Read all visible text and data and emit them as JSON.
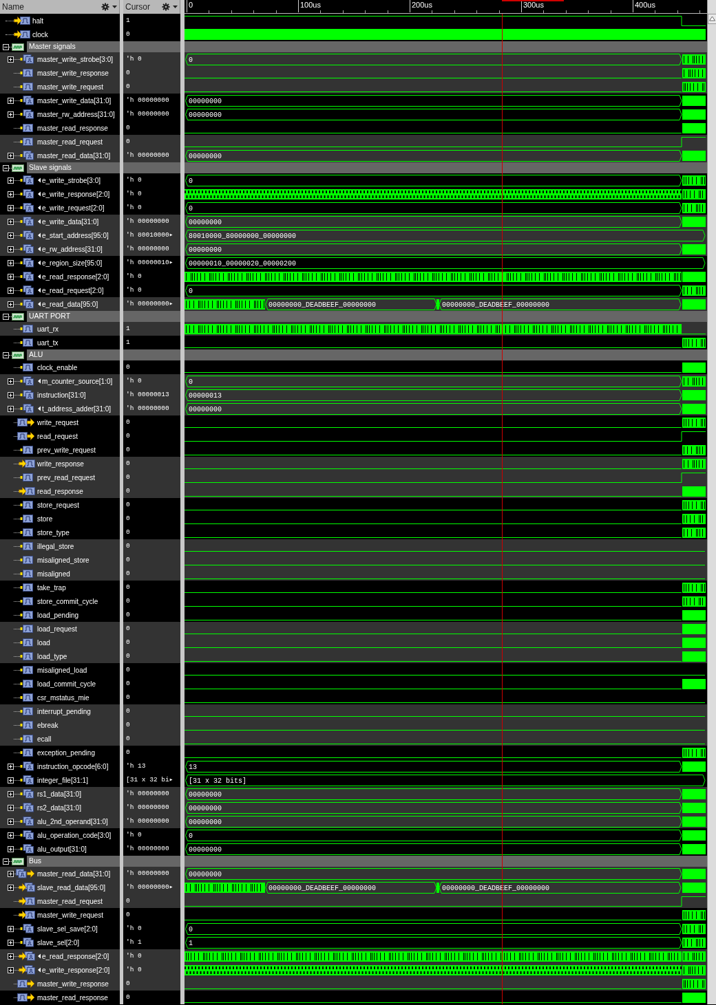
{
  "columns": {
    "name": "Name",
    "cursor": "Cursor"
  },
  "ruler": {
    "ticks": [
      "0",
      "100us",
      "200us",
      "300us",
      "400us"
    ]
  },
  "rows": [
    {
      "kind": "in",
      "name": "halt",
      "value": "1",
      "truncated": false,
      "wave": {
        "kind": "high-fall"
      }
    },
    {
      "kind": "in",
      "name": "clock",
      "value": "0",
      "truncated": false,
      "wave": {
        "kind": "clock"
      }
    },
    {
      "kind": "group",
      "name": "Master signals",
      "expanded": true,
      "children": [
        {
          "kind": "bus",
          "name": "master_write_strobe[3:0]",
          "value": "'h 0",
          "truncated": false,
          "expanded": false,
          "wave": {
            "kind": "bus-ticks",
            "label": "0"
          }
        },
        {
          "kind": "internal",
          "name": "master_write_response",
          "value": "0",
          "truncated": false,
          "wave": {
            "kind": "low-ticks"
          }
        },
        {
          "kind": "internal",
          "name": "master_write_request",
          "value": "0",
          "truncated": false,
          "wave": {
            "kind": "low-ticks"
          }
        },
        {
          "kind": "bus",
          "name": "master_write_data[31:0]",
          "value": "'h 00000000",
          "truncated": false,
          "expanded": false,
          "wave": {
            "kind": "bus-solid",
            "label": "00000000"
          }
        },
        {
          "kind": "bus",
          "name": "master_rw_address[31:0]",
          "value": "'h 00000000",
          "truncated": false,
          "expanded": false,
          "wave": {
            "kind": "bus-solid",
            "label": "00000000"
          }
        },
        {
          "kind": "internal",
          "name": "master_read_response",
          "value": "0",
          "truncated": false,
          "wave": {
            "kind": "low-solid"
          }
        },
        {
          "kind": "internal",
          "name": "master_read_request",
          "value": "0",
          "truncated": false,
          "wave": {
            "kind": "low-rise"
          }
        },
        {
          "kind": "bus",
          "name": "master_read_data[31:0]",
          "value": "'h 00000000",
          "truncated": false,
          "expanded": false,
          "wave": {
            "kind": "bus-solid",
            "label": "00000000"
          }
        }
      ]
    },
    {
      "kind": "group",
      "name": "Slave signals",
      "expanded": true,
      "children": [
        {
          "kind": "bus",
          "name": "e_write_strobe[3:0]",
          "value": "'h 0",
          "truncated": true,
          "expanded": false,
          "wave": {
            "kind": "bus-ticks",
            "label": "0"
          }
        },
        {
          "kind": "bus",
          "name": "e_write_response[2:0]",
          "value": "'h 0",
          "truncated": true,
          "expanded": false,
          "wave": {
            "kind": "toggle-ticks"
          }
        },
        {
          "kind": "bus",
          "name": "e_write_request[2:0]",
          "value": "'h 0",
          "truncated": true,
          "expanded": false,
          "wave": {
            "kind": "bus-ticks",
            "label": "0"
          }
        },
        {
          "kind": "bus",
          "name": "e_write_data[31:0]",
          "value": "'h 00000000",
          "truncated": true,
          "expanded": false,
          "wave": {
            "kind": "bus-solid",
            "label": "00000000"
          }
        },
        {
          "kind": "bus",
          "name": "e_start_address[95:0]",
          "value": "'h 80010000▸",
          "truncated": true,
          "expanded": false,
          "wave": {
            "kind": "bus-none",
            "label": "80010000_80000000_00000000"
          }
        },
        {
          "kind": "bus",
          "name": "e_rw_address[31:0]",
          "value": "'h 00000000",
          "truncated": true,
          "expanded": false,
          "wave": {
            "kind": "bus-solid",
            "label": "00000000"
          }
        },
        {
          "kind": "bus",
          "name": "e_region_size[95:0]",
          "value": "'h 00000010▸",
          "truncated": true,
          "expanded": false,
          "wave": {
            "kind": "bus-none",
            "label": "00000010_00000020_00000200"
          }
        },
        {
          "kind": "bus",
          "name": "e_read_response[2:0]",
          "value": "'h 0",
          "truncated": true,
          "expanded": false,
          "wave": {
            "kind": "pulses-solid"
          }
        },
        {
          "kind": "bus",
          "name": "e_read_request[2:0]",
          "value": "'h 0",
          "truncated": true,
          "expanded": false,
          "wave": {
            "kind": "bus-ticks",
            "label": "0"
          }
        },
        {
          "kind": "bus",
          "name": "e_read_data[95:0]",
          "value": "'h 00000000▸",
          "truncated": true,
          "expanded": false,
          "wave": {
            "kind": "mixed-solid",
            "labels": [
              "00000000_DEADBEEF_00000000",
              "00000000_DEADBEEF_00000000"
            ]
          }
        }
      ]
    },
    {
      "kind": "group",
      "name": "UART PORT",
      "expanded": true,
      "children": [
        {
          "kind": "internal",
          "name": "uart_rx",
          "value": "1",
          "truncated": false,
          "wave": {
            "kind": "pulses-low"
          }
        },
        {
          "kind": "internal",
          "name": "uart_tx",
          "value": "1",
          "truncated": false,
          "wave": {
            "kind": "low-ticks"
          }
        }
      ]
    },
    {
      "kind": "group",
      "name": "ALU",
      "expanded": true,
      "children": [
        {
          "kind": "internal",
          "name": "clock_enable",
          "value": "0",
          "truncated": false,
          "wave": {
            "kind": "low-solid"
          }
        },
        {
          "kind": "bus",
          "name": "m_counter_source[1:0]",
          "value": "'h 0",
          "truncated": true,
          "expanded": false,
          "wave": {
            "kind": "bus-ticks",
            "label": "0"
          }
        },
        {
          "kind": "bus",
          "name": "instruction[31:0]",
          "value": "'h 00000013",
          "truncated": false,
          "expanded": false,
          "wave": {
            "kind": "bus-solid",
            "label": "00000013"
          }
        },
        {
          "kind": "bus",
          "name": "t_address_adder[31:0]",
          "value": "'h 00000000",
          "truncated": true,
          "expanded": false,
          "wave": {
            "kind": "bus-solid",
            "label": "00000000"
          }
        },
        {
          "kind": "out",
          "name": "write_request",
          "value": "0",
          "truncated": false,
          "wave": {
            "kind": "low-ticks"
          }
        },
        {
          "kind": "out",
          "name": "read_request",
          "value": "0",
          "truncated": false,
          "wave": {
            "kind": "low-rise"
          }
        },
        {
          "kind": "internal",
          "name": "prev_write_request",
          "value": "0",
          "truncated": false,
          "wave": {
            "kind": "low-ticks"
          }
        },
        {
          "kind": "in",
          "name": "write_response",
          "value": "0",
          "truncated": false,
          "wave": {
            "kind": "low-ticks"
          }
        },
        {
          "kind": "internal",
          "name": "prev_read_request",
          "value": "0",
          "truncated": false,
          "wave": {
            "kind": "low-rise"
          }
        },
        {
          "kind": "in",
          "name": "read_response",
          "value": "0",
          "truncated": false,
          "wave": {
            "kind": "low-solid"
          }
        },
        {
          "kind": "internal",
          "name": "store_request",
          "value": "0",
          "truncated": false,
          "wave": {
            "kind": "low-ticks"
          }
        },
        {
          "kind": "internal",
          "name": "store",
          "value": "0",
          "truncated": false,
          "wave": {
            "kind": "low-ticks"
          }
        },
        {
          "kind": "internal",
          "name": "store_type",
          "value": "0",
          "truncated": false,
          "wave": {
            "kind": "low-ticks"
          }
        },
        {
          "kind": "internal",
          "name": "illegal_store",
          "value": "0",
          "truncated": false,
          "wave": {
            "kind": "low-none"
          }
        },
        {
          "kind": "internal",
          "name": "misaligned_store",
          "value": "0",
          "truncated": false,
          "wave": {
            "kind": "low-none"
          }
        },
        {
          "kind": "internal",
          "name": "misaligned",
          "value": "0",
          "truncated": false,
          "wave": {
            "kind": "low-none"
          }
        },
        {
          "kind": "internal",
          "name": "take_trap",
          "value": "0",
          "truncated": false,
          "wave": {
            "kind": "low-ticks"
          }
        },
        {
          "kind": "internal",
          "name": "store_commit_cycle",
          "value": "0",
          "truncated": false,
          "wave": {
            "kind": "low-ticks"
          }
        },
        {
          "kind": "internal",
          "name": "load_pending",
          "value": "0",
          "truncated": false,
          "wave": {
            "kind": "low-solid"
          }
        },
        {
          "kind": "internal",
          "name": "load_request",
          "value": "0",
          "truncated": false,
          "wave": {
            "kind": "low-solid"
          }
        },
        {
          "kind": "internal",
          "name": "load",
          "value": "0",
          "truncated": false,
          "wave": {
            "kind": "low-solid"
          }
        },
        {
          "kind": "internal",
          "name": "load_type",
          "value": "0",
          "truncated": false,
          "wave": {
            "kind": "low-solid"
          }
        },
        {
          "kind": "internal",
          "name": "misaligned_load",
          "value": "0",
          "truncated": false,
          "wave": {
            "kind": "low-none"
          }
        },
        {
          "kind": "internal",
          "name": "load_commit_cycle",
          "value": "0",
          "truncated": false,
          "wave": {
            "kind": "low-solid"
          }
        },
        {
          "kind": "internal",
          "name": "csr_mstatus_mie",
          "value": "0",
          "truncated": false,
          "wave": {
            "kind": "low-none"
          }
        },
        {
          "kind": "internal",
          "name": "interrupt_pending",
          "value": "0",
          "truncated": false,
          "wave": {
            "kind": "low-none"
          }
        },
        {
          "kind": "internal",
          "name": "ebreak",
          "value": "0",
          "truncated": false,
          "wave": {
            "kind": "low-none"
          }
        },
        {
          "kind": "internal",
          "name": "ecall",
          "value": "0",
          "truncated": false,
          "wave": {
            "kind": "low-none"
          }
        },
        {
          "kind": "internal",
          "name": "exception_pending",
          "value": "0",
          "truncated": false,
          "wave": {
            "kind": "low-ticks"
          }
        },
        {
          "kind": "bus",
          "name": "instruction_opcode[6:0]",
          "value": "'h 13",
          "truncated": false,
          "expanded": false,
          "wave": {
            "kind": "bus-solid",
            "label": "13"
          }
        },
        {
          "kind": "bus",
          "name": "integer_file[31:1]",
          "value": "[31 x 32 bi▸",
          "truncated": false,
          "expanded": false,
          "wave": {
            "kind": "bus-none",
            "label": "[31 x 32 bits]"
          }
        },
        {
          "kind": "bus",
          "name": "rs1_data[31:0]",
          "value": "'h 00000000",
          "truncated": false,
          "expanded": false,
          "wave": {
            "kind": "bus-solid",
            "label": "00000000"
          }
        },
        {
          "kind": "bus",
          "name": "rs2_data[31:0]",
          "value": "'h 00000000",
          "truncated": false,
          "expanded": false,
          "wave": {
            "kind": "bus-solid",
            "label": "00000000"
          }
        },
        {
          "kind": "bus",
          "name": "alu_2nd_operand[31:0]",
          "value": "'h 00000000",
          "truncated": false,
          "expanded": false,
          "wave": {
            "kind": "bus-solid",
            "label": "00000000"
          }
        },
        {
          "kind": "bus",
          "name": "alu_operation_code[3:0]",
          "value": "'h 0",
          "truncated": false,
          "expanded": false,
          "wave": {
            "kind": "bus-solid",
            "label": "0"
          }
        },
        {
          "kind": "bus",
          "name": "alu_output[31:0]",
          "value": "'h 00000000",
          "truncated": false,
          "expanded": false,
          "wave": {
            "kind": "bus-solid",
            "label": "00000000"
          }
        }
      ]
    },
    {
      "kind": "group",
      "name": "Bus",
      "expanded": true,
      "children": [
        {
          "kind": "bus-out",
          "name": "master_read_data[31:0]",
          "value": "'h 00000000",
          "truncated": false,
          "expanded": false,
          "wave": {
            "kind": "bus-solid",
            "label": "00000000"
          }
        },
        {
          "kind": "bus-in",
          "name": "slave_read_data[95:0]",
          "value": "'h 00000000▸",
          "truncated": false,
          "expanded": false,
          "wave": {
            "kind": "mixed-solid",
            "labels": [
              "00000000_DEADBEEF_00000000",
              "00000000_DEADBEEF_00000000"
            ]
          }
        },
        {
          "kind": "in",
          "name": "master_read_request",
          "value": "0",
          "truncated": false,
          "wave": {
            "kind": "low-rise"
          }
        },
        {
          "kind": "in",
          "name": "master_write_request",
          "value": "0",
          "truncated": false,
          "wave": {
            "kind": "low-ticks"
          }
        },
        {
          "kind": "bus",
          "name": "slave_sel_save[2:0]",
          "value": "'h 0",
          "truncated": false,
          "expanded": false,
          "wave": {
            "kind": "bus-ticks",
            "label": "0"
          }
        },
        {
          "kind": "bus",
          "name": "slave_sel[2:0]",
          "value": "'h 1",
          "truncated": false,
          "expanded": false,
          "wave": {
            "kind": "bus-ticks",
            "label": "1"
          }
        },
        {
          "kind": "bus-in",
          "name": "e_read_response[2:0]",
          "value": "'h 0",
          "truncated": true,
          "expanded": false,
          "wave": {
            "kind": "pulses-ticks"
          }
        },
        {
          "kind": "bus-in",
          "name": "e_write_response[2:0]",
          "value": "'h 0",
          "truncated": true,
          "expanded": false,
          "wave": {
            "kind": "toggle-ticks"
          }
        },
        {
          "kind": "out",
          "name": "master_write_response",
          "value": "0",
          "truncated": false,
          "wave": {
            "kind": "low-ticks"
          }
        },
        {
          "kind": "out",
          "name": "master_read_response",
          "value": "0",
          "truncated": false,
          "wave": {
            "kind": "low-solid"
          }
        }
      ]
    }
  ]
}
